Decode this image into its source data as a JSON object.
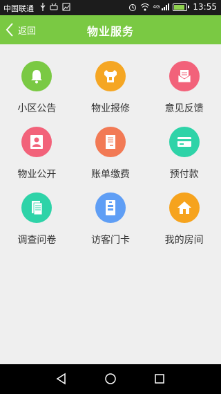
{
  "status_bar": {
    "carrier": "中国联通",
    "network": "4G",
    "time": "13:55",
    "battery_level": 0.9
  },
  "header": {
    "back_label": "返回",
    "title": "物业服务"
  },
  "colors": {
    "header": "#7ac943",
    "tile_green": "#7ac943",
    "tile_orange": "#f5a623",
    "tile_pink": "#f2627a",
    "tile_coral": "#f27a55",
    "tile_teal": "#2ed3a8",
    "tile_blue": "#5f9ef5",
    "tile_amber": "#f6a31d"
  },
  "menu": [
    {
      "label": "小区公告",
      "icon": "bell-icon"
    },
    {
      "label": "物业报修",
      "icon": "wrench-icon"
    },
    {
      "label": "意见反馈",
      "icon": "mail-feedback-icon"
    },
    {
      "label": "物业公开",
      "icon": "person-card-icon"
    },
    {
      "label": "账单缴费",
      "icon": "bill-icon"
    },
    {
      "label": "预付款",
      "icon": "bank-card-icon"
    },
    {
      "label": "调查问卷",
      "icon": "questionnaire-icon"
    },
    {
      "label": "访客门卡",
      "icon": "visitor-card-icon"
    },
    {
      "label": "我的房间",
      "icon": "home-icon"
    }
  ]
}
